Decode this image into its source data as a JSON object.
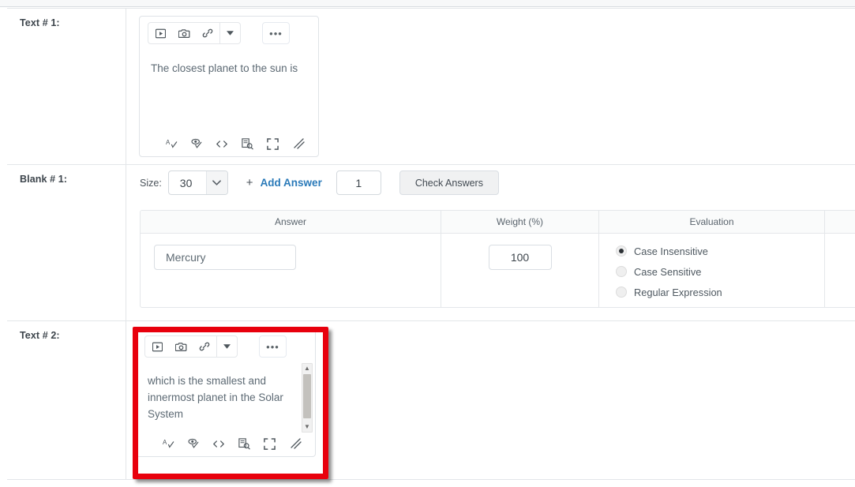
{
  "rows": [
    {
      "label": "Text # 1:",
      "type": "editor",
      "editor": {
        "toolbar": {
          "video_icon": "video-insert-icon",
          "image_icon": "camera-image-icon",
          "link_icon": "link-icon",
          "dropdown_icon": "chevron-down-icon",
          "more_label": "•••",
          "more_icon": "more-options-icon"
        },
        "content": "The closest planet to the sun is",
        "statusbar": {
          "spellcheck_icon": "spellcheck-icon",
          "accessibility_icon": "accessibility-checker-icon",
          "html_icon": "html-editor-icon",
          "wordcount_icon": "word-count-icon",
          "fullscreen_icon": "fullscreen-icon",
          "resize_icon": "resize-handle-icon"
        },
        "scrollbar": false,
        "highlighted": false
      }
    },
    {
      "label": "Blank # 1:",
      "type": "blank",
      "controls": {
        "size_label": "Size:",
        "size_value": "30",
        "size_caret_icon": "chevron-down-icon",
        "plus_icon": "+",
        "add_answer_label": "Add Answer",
        "answer_count": "1",
        "check_answers_label": "Check Answers"
      },
      "table": {
        "headers": [
          "Answer",
          "Weight (%)",
          "Evaluation",
          ""
        ],
        "rows": [
          {
            "answer": "Mercury",
            "weight": "100",
            "evaluation_options": [
              {
                "label": "Case Insensitive",
                "selected": true
              },
              {
                "label": "Case Sensitive",
                "selected": false
              },
              {
                "label": "Regular Expression",
                "selected": false
              }
            ]
          }
        ]
      }
    },
    {
      "label": "Text # 2:",
      "type": "editor",
      "editor": {
        "toolbar": {
          "video_icon": "video-insert-icon",
          "image_icon": "camera-image-icon",
          "link_icon": "link-icon",
          "dropdown_icon": "chevron-down-icon",
          "more_label": "•••",
          "more_icon": "more-options-icon"
        },
        "content": "which is the smallest and innermost planet in the Solar System",
        "statusbar": {
          "spellcheck_icon": "spellcheck-icon",
          "accessibility_icon": "accessibility-checker-icon",
          "html_icon": "html-editor-icon",
          "wordcount_icon": "word-count-icon",
          "fullscreen_icon": "fullscreen-icon",
          "resize_icon": "resize-handle-icon"
        },
        "scrollbar": true,
        "scrollbar_up_icon": "▲",
        "scrollbar_down_icon": "▼",
        "highlighted": true
      }
    }
  ],
  "colors": {
    "link": "#2a7ab9",
    "highlight_box": "#e8000d",
    "text": "#4e5860",
    "editor_text": "#5d6a74",
    "border": "#e4e7ea"
  }
}
